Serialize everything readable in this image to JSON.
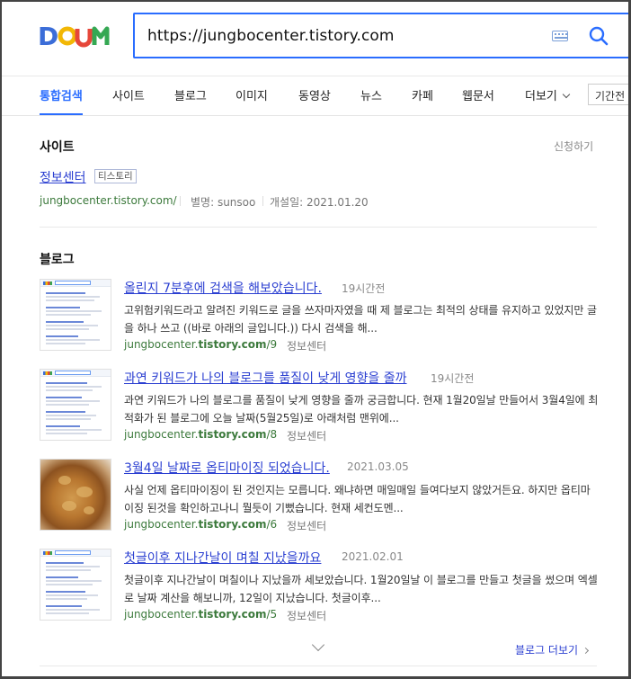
{
  "header": {
    "logo_text": "Daum",
    "search_query": "https://jungbocenter.tistory.com",
    "keyboard_icon": "keyboard-icon",
    "search_icon": "search-icon"
  },
  "tabs": [
    {
      "label": "통합검색",
      "active": true
    },
    {
      "label": "사이트"
    },
    {
      "label": "블로그"
    },
    {
      "label": "이미지"
    },
    {
      "label": "동영상"
    },
    {
      "label": "뉴스"
    },
    {
      "label": "카페"
    },
    {
      "label": "웹문서"
    },
    {
      "label": "더보기"
    }
  ],
  "period_button": "기간전",
  "site_section": {
    "title": "사이트",
    "apply_link": "신청하기",
    "site_name": "정보센터",
    "badge": "티스토리",
    "url": "jungbocenter.tistory.com/",
    "alias": "별명: sunsoo",
    "opened": "개설일: 2021.01.20"
  },
  "blog_section": {
    "title": "블로그",
    "posts": [
      {
        "title": "올린지 7분후에 검색을 해보았습니다.",
        "time": "19시간전",
        "desc": "고위험키워드라고 알려진 키워드로 글을 쓰자마자였을 때 제 블로그는 최적의 상태를 유지하고 있었지만 글을 하나 쓰고 ((바로 아래의 글입니다.)) 다시 검색을 해...",
        "url_prefix": "jungbocenter.",
        "url_bold": "tistory.com",
        "url_suffix": "/9",
        "source": "정보센터",
        "thumb": "screenshot"
      },
      {
        "title": "과연 키워드가 나의 블로그를 품질이 낮게 영향을 줄까",
        "time": "19시간전",
        "desc": "과연 키워드가 나의 블로그를 품질이 낮게 영향을 줄까 궁금합니다. 현재 1월20일날 만들어서 3월4일에 최적화가 된 블로그에 오늘 날짜(5월25일)로 아래처럼 맨위에...",
        "url_prefix": "jungbocenter.",
        "url_bold": "tistory.com",
        "url_suffix": "/8",
        "source": "정보센터",
        "thumb": "screenshot"
      },
      {
        "title": "3월4일 날짜로 옵티마이징 되었습니다.",
        "time": "2021.03.05",
        "desc": "사실 언제 옵티마이징이 된 것인지는 모릅니다. 왜냐하면 매일매일 들여다보지 않았거든요. 하지만 옵티마이징 된것을 확인하고나니 뭘듯이 기뻤습니다. 현재 세컨도멘...",
        "url_prefix": "jungbocenter.",
        "url_bold": "tistory.com",
        "url_suffix": "/6",
        "source": "정보센터",
        "thumb": "food"
      },
      {
        "title": "첫글이후 지나간날이 며칠 지났을까요",
        "time": "2021.02.01",
        "desc": "첫글이후 지나간날이 며칠이나 지났을까 세보았습니다. 1월20일날 이 블로그를 만들고 첫글을 썼으며 엑셀로 날짜 계산을 해보니까, 12일이 지났습니다. 첫글이후...",
        "url_prefix": "jungbocenter.",
        "url_bold": "tistory.com",
        "url_suffix": "/5",
        "source": "정보센터",
        "thumb": "screenshot"
      }
    ],
    "more_link": "블로그 더보기"
  },
  "colors": {
    "accent": "#2a6dff",
    "link": "#2b3fd1",
    "url_green": "#3c7a3c"
  }
}
